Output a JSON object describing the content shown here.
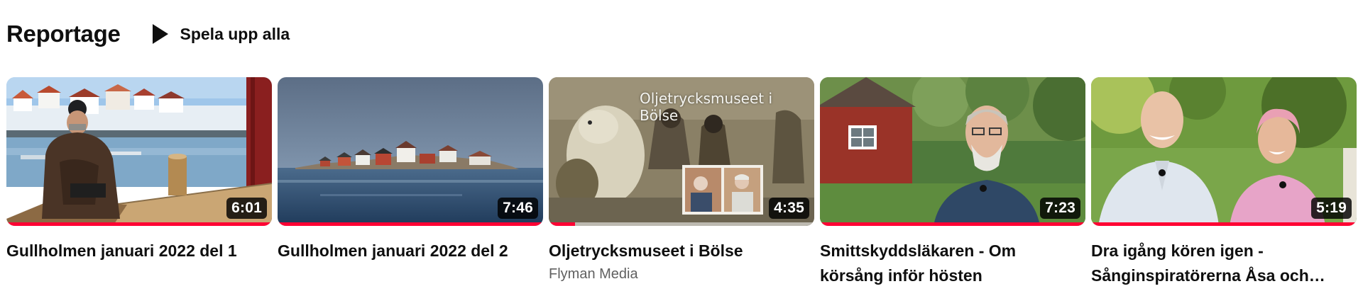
{
  "shelf": {
    "title": "Reportage",
    "play_all_label": "Spela upp alla"
  },
  "videos": [
    {
      "title": "Gullholmen januari 2022 del 1",
      "duration": "6:01",
      "watched_fraction": 1.0,
      "channel": ""
    },
    {
      "title": "Gullholmen januari 2022 del 2",
      "duration": "7:46",
      "watched_fraction": 1.0,
      "channel": ""
    },
    {
      "title": "Oljetrycksmuseet i Bölse",
      "duration": "4:35",
      "watched_fraction": 0.1,
      "channel": "Flyman Media",
      "thumbnail_text": "Oljetrycksmuseet i Bölse"
    },
    {
      "title": "Smittskyddsläkaren - Om körsång inför hösten",
      "duration": "7:23",
      "watched_fraction": 1.0,
      "channel": ""
    },
    {
      "title": "Dra igång kören igen - Sånginspiratörerna Åsa och…",
      "duration": "5:19",
      "watched_fraction": 1.0,
      "channel": ""
    }
  ],
  "colors": {
    "progress": "#ff0033",
    "secondary_text": "#606060"
  },
  "icons": {
    "play_all": "play-triangle-icon"
  }
}
